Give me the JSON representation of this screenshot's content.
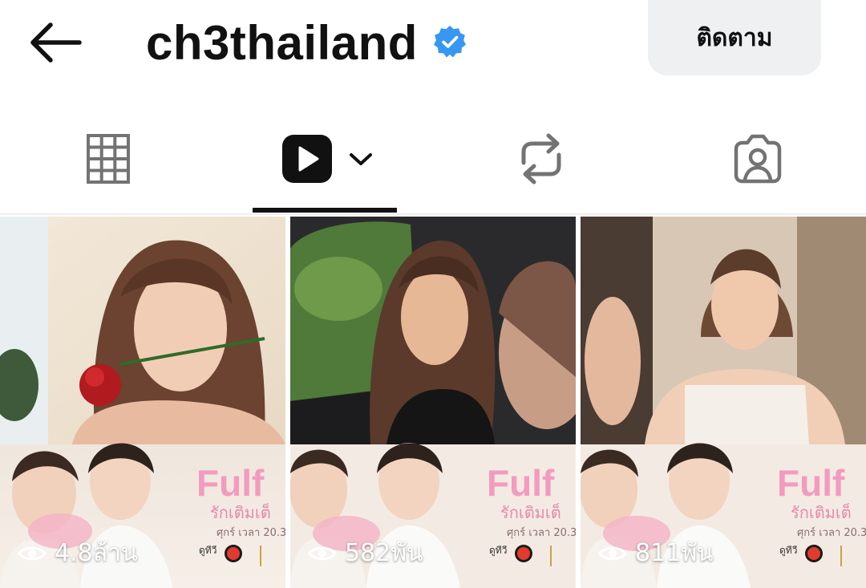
{
  "header": {
    "username": "ch3thailand",
    "verified": true,
    "follow_label": "ติดตาม"
  },
  "tabs": [
    {
      "icon": "grid-icon",
      "selected": false
    },
    {
      "icon": "reels-icon",
      "selected": true
    },
    {
      "icon": "reposts-icon",
      "selected": false
    },
    {
      "icon": "tagged-icon",
      "selected": false
    }
  ],
  "reels": [
    {
      "views": "4.8ล้าน",
      "poster_title": "Fulf",
      "poster_subtitle": "รักเติมเต็",
      "poster_time": "ศุกร์ เวลา 20.3",
      "poster_channel": "ดูทีวี"
    },
    {
      "views": "582พัน",
      "poster_title": "Fulf",
      "poster_subtitle": "รักเติมเต็",
      "poster_time": "ศุกร์ เวลา 20.3",
      "poster_channel": "ดูทีวี"
    },
    {
      "views": "811พัน",
      "poster_title": "Fulf",
      "poster_subtitle": "รักเติมเต็",
      "poster_time": "ศุกร์ เวลา 20.3",
      "poster_channel": "ดูทีวี"
    }
  ],
  "colors": {
    "verified_blue": "#3897f0",
    "follow_bg": "#eff0f2",
    "poster_pink": "#f4a8c7",
    "icon_gray": "#737373"
  }
}
